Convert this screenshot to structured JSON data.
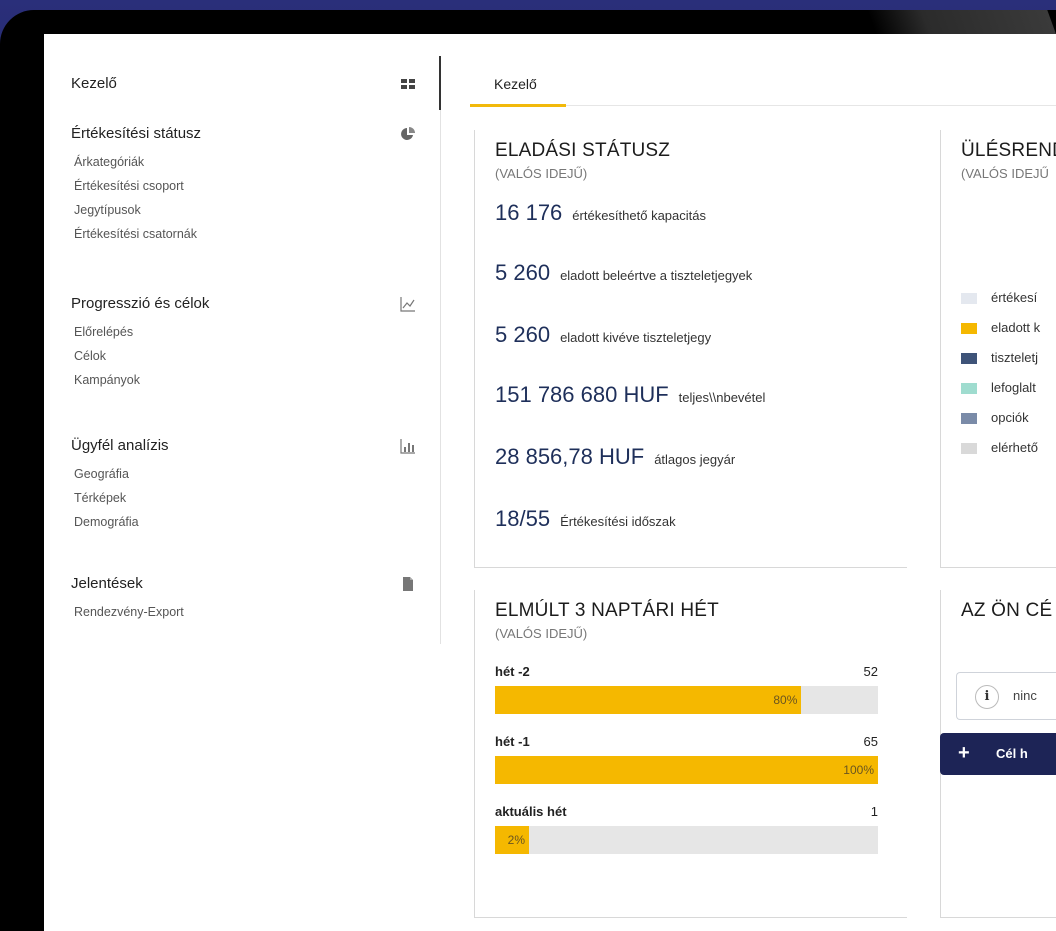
{
  "sidebar": {
    "sections": [
      {
        "title": "Kezelő",
        "icon": "dashboard-grid-icon",
        "items": []
      },
      {
        "title": "Értékesítési státusz",
        "icon": "pie-chart-icon",
        "items": [
          "Árkategóriák",
          "Értékesítési csoport",
          "Jegytípusok",
          "Értékesítési csatornák"
        ]
      },
      {
        "title": "Progresszió és célok",
        "icon": "line-chart-icon",
        "items": [
          "Előrelépés",
          "Célok",
          "Kampányok"
        ]
      },
      {
        "title": "Ügyfél analízis",
        "icon": "bar-chart-icon",
        "items": [
          "Geográfia",
          "Térképek",
          "Demográfia"
        ]
      },
      {
        "title": "Jelentések",
        "icon": "document-icon",
        "items": [
          "Rendezvény-Export"
        ]
      }
    ]
  },
  "tabs": [
    {
      "label": "Kezelő",
      "active": true
    }
  ],
  "sales_status": {
    "title": "ELADÁSI STÁTUSZ",
    "subtitle": "(VALÓS IDEJŰ)",
    "stats": [
      {
        "value": "16 176",
        "label": "értékesíthető kapacitás"
      },
      {
        "value": "5 260",
        "label": "eladott beleértve a tiszteletjegyek"
      },
      {
        "value": "5 260",
        "label": "eladott kivéve tiszteletjegy"
      },
      {
        "value": "151 786 680 HUF",
        "label": "teljes\\\\nbevétel"
      },
      {
        "value": "28 856,78 HUF",
        "label": "átlagos jegyár"
      },
      {
        "value": "18/55",
        "label": "Értékesítési időszak"
      }
    ]
  },
  "seating": {
    "title": "ÜLÉSREND",
    "subtitle": "(VALÓS IDEJŰ",
    "legend": [
      {
        "label": "értékesí",
        "color": "#e4e8ef"
      },
      {
        "label": "eladott k",
        "color": "#f5b800"
      },
      {
        "label": "tiszteletj",
        "color": "#3e5378"
      },
      {
        "label": "lefoglalt",
        "color": "#9fdccf"
      },
      {
        "label": "opciók",
        "color": "#7a8ba8"
      },
      {
        "label": "elérhető",
        "color": "#d9d9d9"
      }
    ]
  },
  "last_weeks": {
    "title": "ELMÚLT 3 NAPTÁRI HÉT",
    "subtitle": "(VALÓS IDEJŰ)",
    "weeks": [
      {
        "label": "hét -2",
        "count": "52",
        "percent_label": "80%",
        "fraction": 0.8
      },
      {
        "label": "hét -1",
        "count": "65",
        "percent_label": "100%",
        "fraction": 1.0
      },
      {
        "label": "aktuális hét",
        "count": "1",
        "percent_label": "2%",
        "fraction": 0.02
      }
    ]
  },
  "goals": {
    "title": "AZ ÖN CÉ",
    "info_text": "ninc",
    "add_button_label": "Cél h"
  },
  "colors": {
    "accent": "#f5b800",
    "navy": "#1d2456",
    "value_text": "#1e2f5a"
  }
}
